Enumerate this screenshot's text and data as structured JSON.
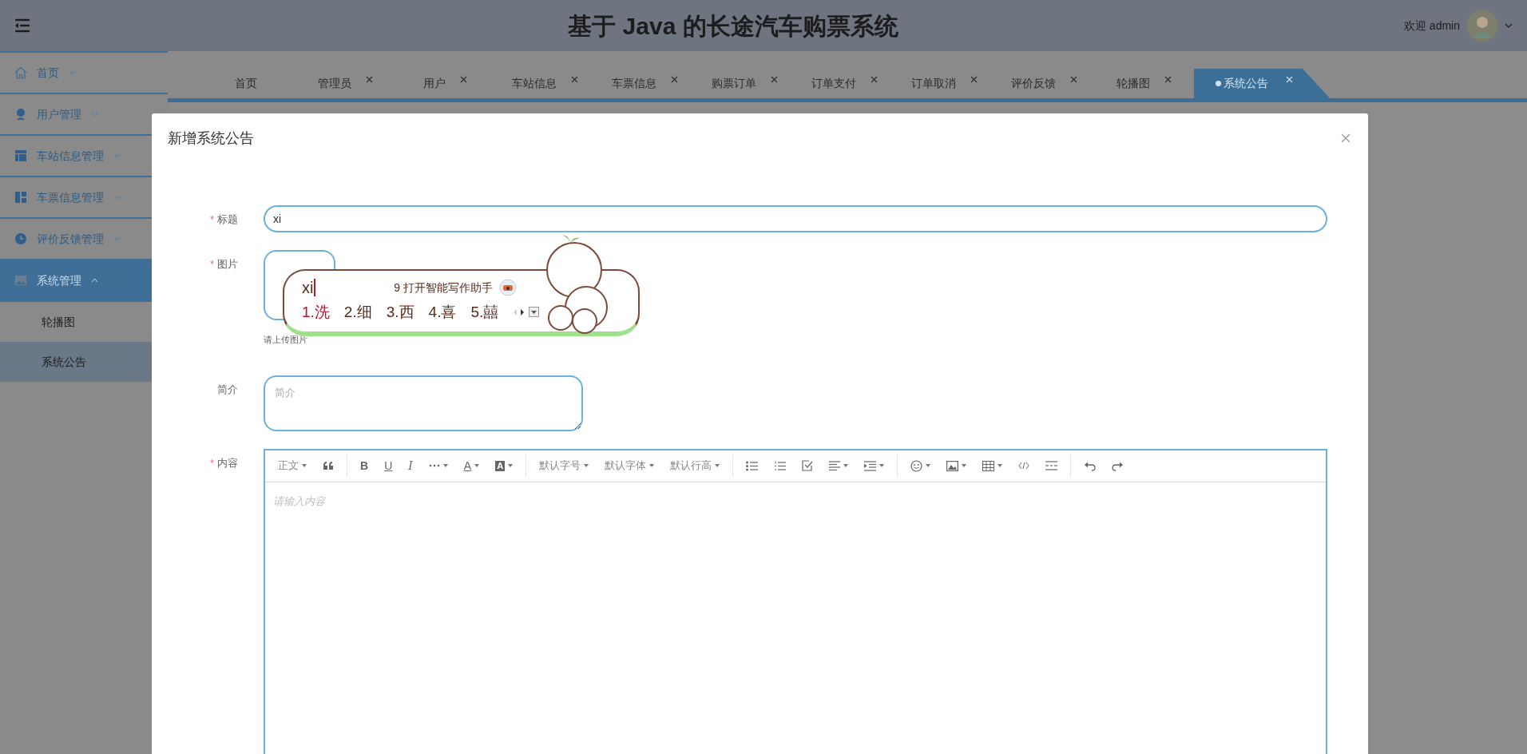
{
  "header": {
    "title": "基于 Java 的长途汽车购票系统",
    "welcome": "欢迎 admin"
  },
  "sidebar": {
    "items": [
      {
        "label": "首页",
        "expanded": false,
        "selected": false
      },
      {
        "label": "用户管理",
        "expanded": false,
        "selected": false
      },
      {
        "label": "车站信息管理",
        "expanded": false,
        "selected": false
      },
      {
        "label": "车票信息管理",
        "expanded": false,
        "selected": false
      },
      {
        "label": "评价反馈管理",
        "expanded": false,
        "selected": false
      },
      {
        "label": "系统管理",
        "expanded": true,
        "selected": true,
        "children": [
          {
            "label": "轮播图",
            "selected": false
          },
          {
            "label": "系统公告",
            "selected": true
          }
        ]
      }
    ]
  },
  "tabs": [
    {
      "label": "首页",
      "closable": false,
      "selected": false
    },
    {
      "label": "管理员",
      "closable": true,
      "selected": false
    },
    {
      "label": "用户",
      "closable": true,
      "selected": false
    },
    {
      "label": "车站信息",
      "closable": true,
      "selected": false
    },
    {
      "label": "车票信息",
      "closable": true,
      "selected": false
    },
    {
      "label": "购票订单",
      "closable": true,
      "selected": false
    },
    {
      "label": "订单支付",
      "closable": true,
      "selected": false
    },
    {
      "label": "订单取消",
      "closable": true,
      "selected": false
    },
    {
      "label": "评价反馈",
      "closable": true,
      "selected": false
    },
    {
      "label": "轮播图",
      "closable": true,
      "selected": false
    },
    {
      "label": "系统公告",
      "closable": true,
      "selected": true
    }
  ],
  "dialog": {
    "title": "新增系统公告",
    "fields": [
      {
        "kind": "input",
        "label": "标题",
        "required_mark": "*",
        "value": "xi"
      },
      {
        "kind": "upload",
        "label": "图片",
        "required_mark": "*",
        "hint": "请上传图片"
      },
      {
        "kind": "textarea",
        "label": "简介",
        "placeholder": "简介"
      },
      {
        "kind": "editor",
        "label": "内容",
        "required_mark": "*",
        "placeholder": "请输入内容",
        "toolbar": [
          [
            {
              "kind": "select",
              "text": "正文"
            },
            {
              "kind": "icon",
              "dropdown": false
            }
          ],
          [
            {
              "kind": "bold",
              "text": "B"
            },
            {
              "kind": "underline",
              "text": "U"
            },
            {
              "kind": "italic",
              "text": "I"
            },
            {
              "kind": "icon",
              "dropdown": true
            },
            {
              "kind": "fontcolor",
              "text": "A"
            },
            {
              "kind": "bgcolor",
              "text": "A"
            }
          ],
          [
            {
              "kind": "select",
              "text": "默认字号"
            },
            {
              "kind": "select",
              "text": "默认字体"
            },
            {
              "kind": "select",
              "text": "默认行高"
            }
          ],
          [
            {
              "kind": "icon",
              "dropdown": false
            },
            {
              "kind": "icon",
              "dropdown": false
            },
            {
              "kind": "icon",
              "dropdown": false
            },
            {
              "kind": "icon",
              "dropdown": true
            },
            {
              "kind": "icon",
              "dropdown": true
            }
          ],
          [
            {
              "kind": "icon",
              "dropdown": true
            },
            {
              "kind": "icon",
              "dropdown": true
            },
            {
              "kind": "icon",
              "dropdown": true
            },
            {
              "kind": "icon",
              "dropdown": false
            },
            {
              "kind": "icon",
              "dropdown": false
            }
          ],
          [
            {
              "kind": "icon",
              "dropdown": false
            },
            {
              "kind": "icon",
              "dropdown": false
            }
          ]
        ]
      }
    ]
  },
  "ime": {
    "composition": "xi",
    "assistant": "9 打开智能写作助手",
    "candidates": [
      {
        "text": "1.洗",
        "selected": true
      },
      {
        "text": "2.细",
        "selected": false
      },
      {
        "text": "3.西",
        "selected": false
      },
      {
        "text": "4.喜",
        "selected": false
      },
      {
        "text": "5.囍",
        "selected": false
      }
    ]
  }
}
